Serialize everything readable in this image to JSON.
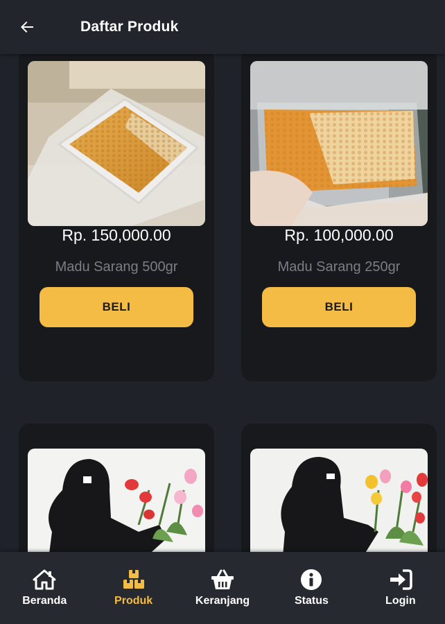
{
  "header": {
    "title": "Daftar Produk",
    "back_icon": "arrow-left-icon"
  },
  "products": [
    {
      "price": "Rp. 150,000.00",
      "name": "Madu Sarang 500gr",
      "buy_label": "BELI",
      "image": "honeycomb-tray-photo"
    },
    {
      "price": "Rp. 100,000.00",
      "name": "Madu Sarang 250gr",
      "buy_label": "BELI",
      "image": "honeycomb-bag-photo"
    },
    {
      "image": "black-niqab-with-flowers-photo"
    },
    {
      "image": "black-niqab-with-tulips-photo"
    }
  ],
  "nav": [
    {
      "label": "Beranda",
      "icon": "home-icon",
      "active": false
    },
    {
      "label": "Produk",
      "icon": "boxes-icon",
      "active": true
    },
    {
      "label": "Keranjang",
      "icon": "basket-icon",
      "active": false
    },
    {
      "label": "Status",
      "icon": "info-icon",
      "active": false
    },
    {
      "label": "Login",
      "icon": "sign-in-icon",
      "active": false
    }
  ],
  "colors": {
    "accent": "#f4bb45",
    "background": "#1f2329",
    "card": "#17191d",
    "nav": "#262a30"
  }
}
